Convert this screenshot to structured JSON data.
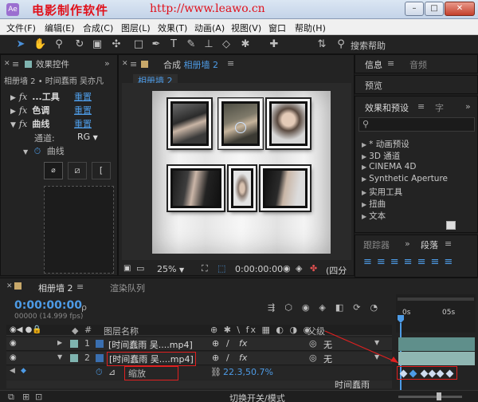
{
  "window": {
    "title": "电影制作软件",
    "url": "http://www.leawo.cn",
    "min": "–",
    "max": "□",
    "close": "✕"
  },
  "menu": [
    "文件(F)",
    "编辑(E)",
    "合成(C)",
    "图层(L)",
    "效果(T)",
    "动画(A)",
    "视图(V)",
    "窗口",
    "帮助(H)"
  ],
  "toolbar": {
    "search_help": "搜索帮助"
  },
  "effects": {
    "tab_label": "效果控件",
    "breadcrumb": "相册墙 2 • 时间蠢雨 吴亦凡",
    "rows": [
      {
        "name": "...工具",
        "reset": "重置"
      },
      {
        "name": "色调",
        "reset": "重置"
      },
      {
        "name": "曲线",
        "reset": "重置"
      }
    ],
    "channel_label": "通道:",
    "channel_value": "RG",
    "curve_label": "曲线"
  },
  "comp": {
    "tab_prefix": "合成",
    "tab_name": "相册墙 2",
    "subtab": "相册墙 2",
    "zoom": "25%",
    "timecode": "0:00:00:00",
    "quality": "(四分"
  },
  "right": {
    "info": "信息",
    "audio": "音频",
    "preview": "预览",
    "presets_tab": "效果和预设",
    "char_tab": "字",
    "presets": [
      "* 动画预设",
      "3D 通道",
      "CINEMA 4D",
      "Synthetic Aperture",
      "实用工具",
      "扭曲",
      "文本"
    ],
    "tracker": "跟踪器",
    "paragraph": "段落"
  },
  "timeline": {
    "tab_name": "相册墙 2",
    "render_queue": "渲染队列",
    "timecode": "0:00:00:00",
    "frames": "00000 (14.999 fps)",
    "search_placeholder": "ρ",
    "col_num": "#",
    "col_layer": "图层名称",
    "col_parent": "父级",
    "ruler_0": "0s",
    "ruler_5": "05s",
    "layers": [
      {
        "num": "1",
        "name": "[时间蠢雨 吴....mp4]",
        "parent": "无"
      },
      {
        "num": "2",
        "name": "[时间蠢雨 吴....mp4]",
        "parent": "无"
      }
    ],
    "prop_name": "缩放",
    "prop_value": "22.3,50.7%",
    "bottom_label": "切换开关/模式",
    "partial_row": "时间蠢雨"
  },
  "colors": {
    "accent": "#4d9be6",
    "layer_chip": "#7fb4b0",
    "red": "#e02020"
  }
}
